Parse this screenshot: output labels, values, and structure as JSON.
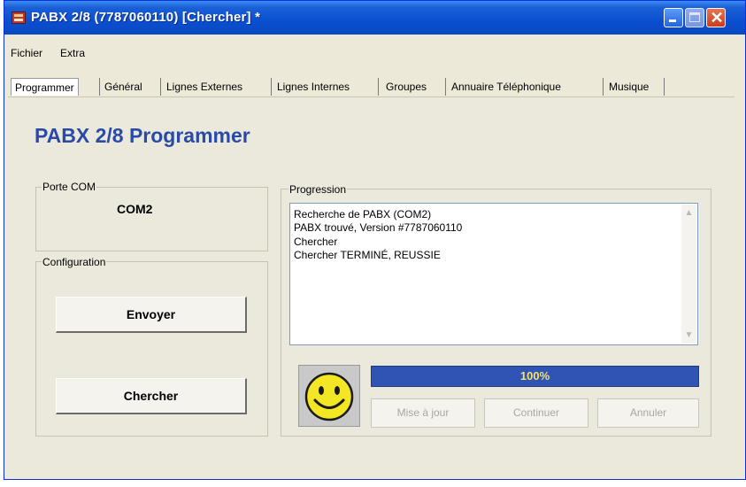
{
  "window": {
    "title": "PABX 2/8 (7787060110) [Chercher] *"
  },
  "menu": {
    "items": [
      "Fichier",
      "Extra"
    ]
  },
  "tabs": [
    {
      "label": "Programmer",
      "active": true
    },
    {
      "label": "Général"
    },
    {
      "label": "Lignes Externes"
    },
    {
      "label": "Lignes Internes"
    },
    {
      "label": "Groupes"
    },
    {
      "label": "Annuaire Téléphonique"
    },
    {
      "label": "Musique"
    }
  ],
  "main": {
    "heading": "PABX 2/8 Programmer",
    "com_port": {
      "label": "Porte COM",
      "value": "COM2"
    },
    "configuration": {
      "label": "Configuration",
      "send_label": "Envoyer",
      "search_label": "Chercher"
    },
    "progress": {
      "label": "Progression",
      "log": [
        "Recherche de PABX (COM2)",
        "PABX trouvé, Version #7787060110",
        "Chercher",
        "Chercher TERMINÉ, REUSSIE"
      ],
      "percent_text": "100%",
      "percent": 100,
      "update_label": "Mise à jour",
      "continue_label": "Continuer",
      "cancel_label": "Annuler"
    }
  },
  "colors": {
    "title_bar": "#0a4fd0",
    "heading": "#2a4aa8",
    "progress_bar": "#2f54b4",
    "progress_text": "#f6e06a",
    "smiley": "#f3e624"
  },
  "icons": [
    "app-icon",
    "minimize-icon",
    "maximize-icon",
    "close-icon",
    "smiley-icon",
    "scroll-up-icon",
    "scroll-down-icon"
  ]
}
